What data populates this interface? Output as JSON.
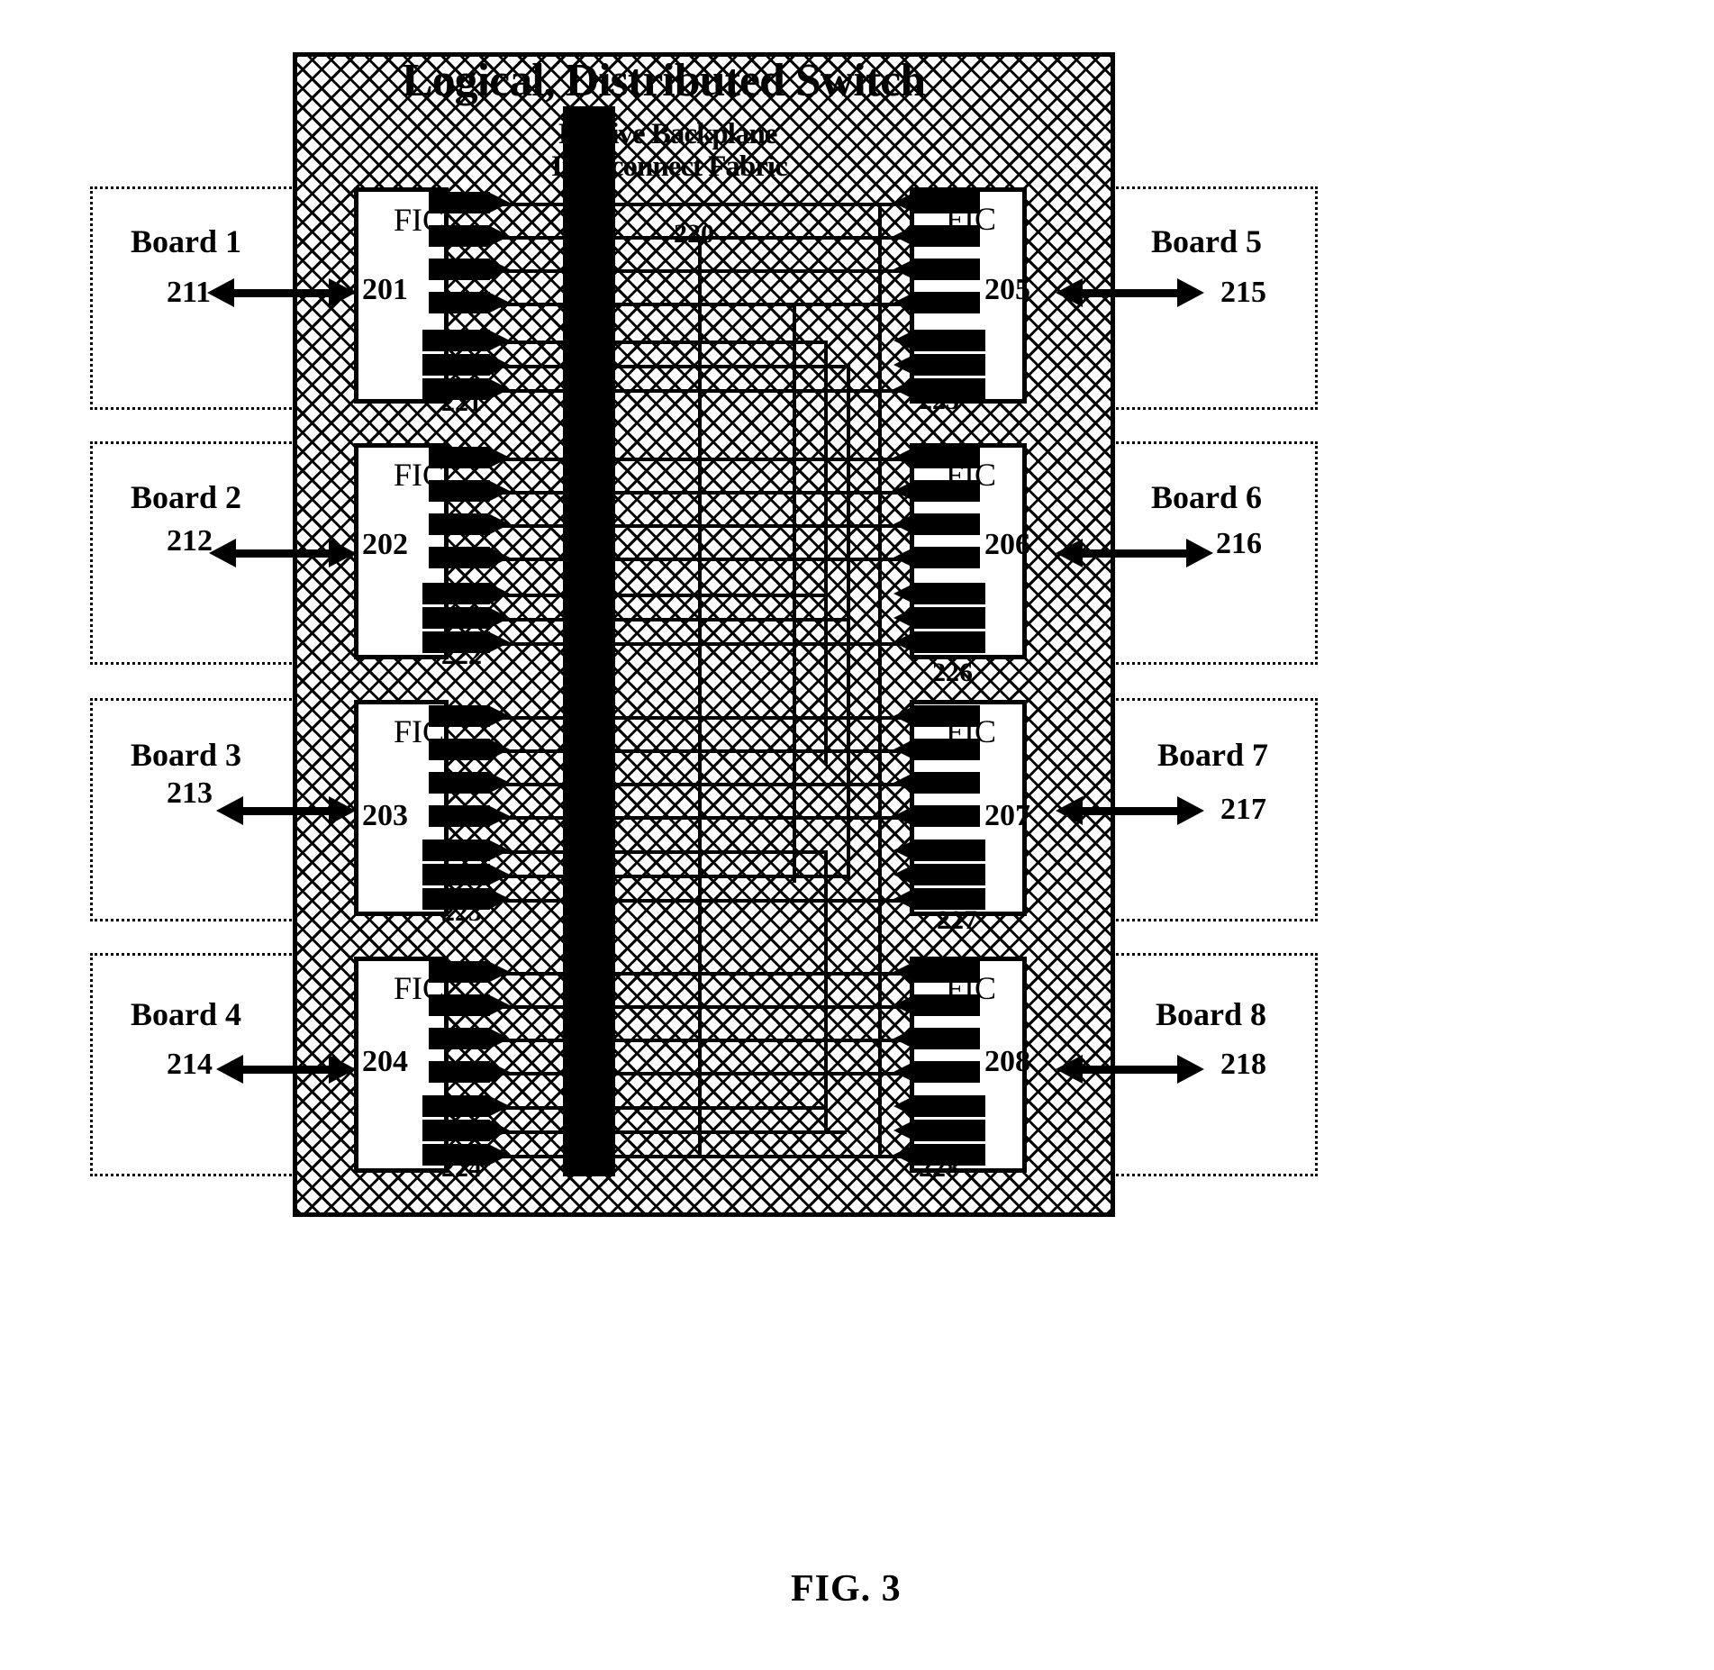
{
  "figure": {
    "caption": "FIG. 3",
    "title_main": "Logical, Distributed Switch",
    "title_sub_line1": "Passive Backplane",
    "title_sub_line2": "Interconnect Fabric"
  },
  "fabric": {
    "name": "passive-backplane-interconnect-fabric",
    "fill": "#000000",
    "background": "#ffffff"
  },
  "boards_left": [
    {
      "label": "Board 1",
      "ref": "211",
      "fic_label": "FIC",
      "fic_ref": "201",
      "conn_ref": "221"
    },
    {
      "label": "Board 2",
      "ref": "212",
      "fic_label": "FIC",
      "fic_ref": "202",
      "conn_ref": "222"
    },
    {
      "label": "Board 3",
      "ref": "213",
      "fic_label": "FIC",
      "fic_ref": "203",
      "conn_ref": "223"
    },
    {
      "label": "Board 4",
      "ref": "214",
      "fic_label": "FIC",
      "fic_ref": "204",
      "conn_ref": "224"
    }
  ],
  "boards_right": [
    {
      "label": "Board 5",
      "ref": "215",
      "fic_label": "FIC",
      "fic_ref": "205",
      "conn_ref": "225"
    },
    {
      "label": "Board 6",
      "ref": "216",
      "fic_label": "FIC",
      "fic_ref": "206",
      "conn_ref": "226"
    },
    {
      "label": "Board 7",
      "ref": "217",
      "fic_label": "FIC",
      "fic_ref": "207",
      "conn_ref": "227"
    },
    {
      "label": "Board 8",
      "ref": "218",
      "fic_label": "FIC",
      "fic_ref": "208",
      "conn_ref": "228"
    }
  ],
  "interconnect": {
    "bus_ref": "220"
  }
}
